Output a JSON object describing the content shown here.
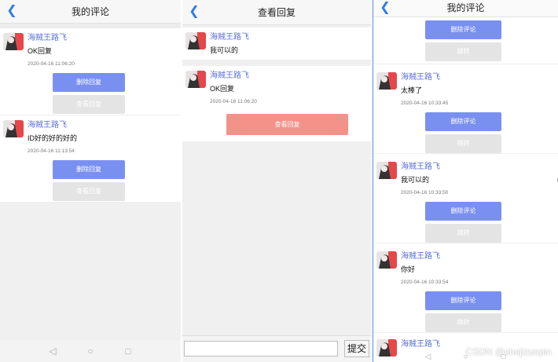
{
  "panel1": {
    "title": "我的评论",
    "comments": [
      {
        "user": "海贼王路飞",
        "text": "OK回复",
        "time": "2020-04-16 11:06:20",
        "btn1": "删除回复",
        "btn2": "查看回复"
      },
      {
        "user": "海贼王路飞",
        "text": "ID好的好的好的",
        "time": "2020-04-16 11:13:54",
        "btn1": "删除回复",
        "btn2": "查看回复"
      }
    ]
  },
  "panel2": {
    "title": "查看回复",
    "items": [
      {
        "user": "海贼王路飞",
        "text": "我可以的"
      },
      {
        "user": "海贼王路飞",
        "text": "OK回复",
        "time": "2020-04-16 11:06:20",
        "btn": "查看回复"
      }
    ],
    "submit": "提交",
    "input_value": ""
  },
  "panel3": {
    "title": "我的评论",
    "top_btn1": "删除评论",
    "top_btn2": "跳转",
    "comments": [
      {
        "user": "海贼王路飞",
        "text": "太棒了",
        "time": "2020-04-16 10:33:45",
        "btn1": "删除评论",
        "btn2": "跳转"
      },
      {
        "user": "海贼王路飞",
        "text": "我可以的",
        "time": "2020-04-16 10:33:50",
        "btn1": "删除评论",
        "btn2": "跳转"
      },
      {
        "user": "海贼王路飞",
        "text": "你好",
        "time": "2020-04-16 10:33:54",
        "btn1": "删除评论",
        "btn2": "跳转"
      },
      {
        "user": "海贼王路飞"
      }
    ]
  },
  "nav_icons": {
    "back": "◁",
    "home": "○",
    "recent": "□"
  },
  "watermark": "CSDN @shejizuopin",
  "colors": {
    "accent": "#2c7be5",
    "username": "#5b6fd8",
    "primary_button": "#7a90f0",
    "disabled_button": "#e4e4e4",
    "danger_button": "#f39289"
  }
}
